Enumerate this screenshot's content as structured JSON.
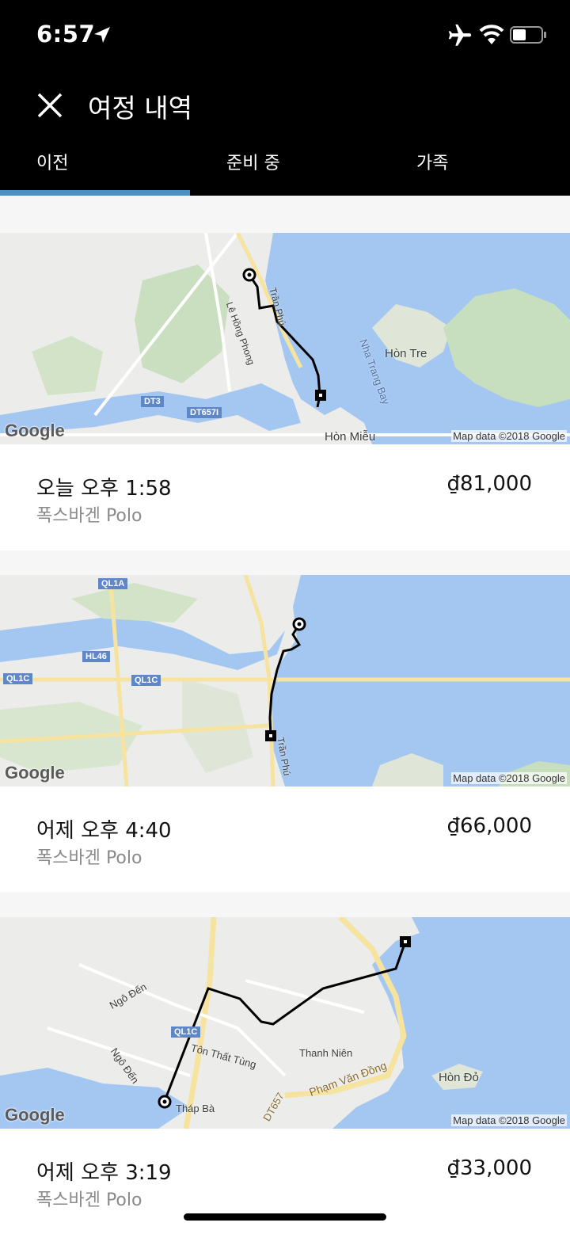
{
  "status_bar": {
    "time": "6:57",
    "icons": [
      "location-arrow-icon",
      "airplane-icon",
      "wifi-icon",
      "battery-icon"
    ]
  },
  "header": {
    "title": "여정 내역",
    "close_icon": "close-icon"
  },
  "tabs": [
    {
      "label": "이전",
      "active": true
    },
    {
      "label": "준비 중",
      "active": false
    },
    {
      "label": "가족",
      "active": false
    }
  ],
  "colors": {
    "header_bg": "#000000",
    "tab_indicator": "#4a90c4",
    "water": "#a4c7f2",
    "land": "#ececea",
    "route": "#000000"
  },
  "map": {
    "logo": "Google",
    "attribution": "Map data ©2018 Google"
  },
  "trips": [
    {
      "when": "오늘 오후 1:58",
      "car": "폭스바겐 Polo",
      "price": "₫81,000",
      "map_labels": {
        "road_1": "DT3",
        "road_2": "DT657I",
        "street_1": "Lê Hồng Phong",
        "street_2": "Trần Phú",
        "place_1": "Hòn Tre",
        "place_2": "Nha Trang Bay",
        "place_3": "Hòn Miễu"
      }
    },
    {
      "when": "어제 오후 4:40",
      "car": "폭스바겐 Polo",
      "price": "₫66,000",
      "map_labels": {
        "road_1": "QL1A",
        "road_2": "HL46",
        "road_3": "QL1C",
        "road_4": "QL1C",
        "street_1": "Trần Phú"
      }
    },
    {
      "when": "어제 오후 3:19",
      "car": "폭스바겐 Polo",
      "price": "₫33,000",
      "map_labels": {
        "road_1": "QL1C",
        "street_1": "Ngô Đến",
        "street_2": "Ngô Đến",
        "street_3": "Tôn Thất Tùng",
        "street_4": "Thanh Niên",
        "street_5": "Phạm Văn Đồng",
        "street_6": "DT657",
        "place_1": "Tháp Bà",
        "place_2": "Hòn Đỏ"
      }
    }
  ]
}
